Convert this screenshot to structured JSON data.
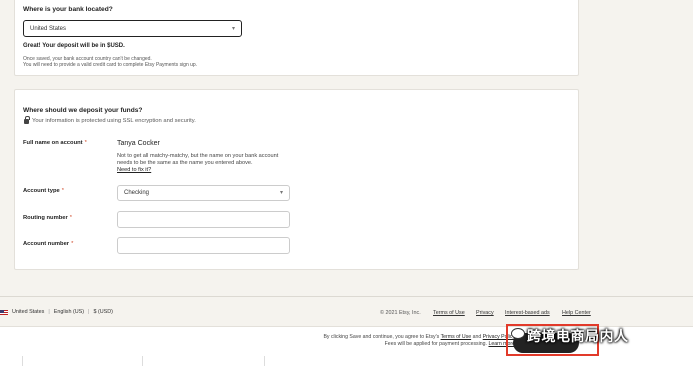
{
  "bank_location": {
    "question": "Where is your bank located?",
    "selected_country": "United States",
    "deposit_message": "Great! Your deposit will be in $USD.",
    "note_line1": "Once saved, your bank account country can't be changed.",
    "note_line2": "You will need to provide a valid credit card to complete Etsy Payments sign up."
  },
  "deposit": {
    "question": "Where should we deposit your funds?",
    "security_note": "Your information is protected using SSL encryption and security.",
    "full_name_label": "Full name on account",
    "full_name_value": "Tanya Cocker",
    "name_warning": "Not to get all matchy-matchy, but the name on your bank account needs to be the same as the name you entered above.",
    "fix_link": "Need to fix it?",
    "account_type_label": "Account type",
    "account_type_value": "Checking",
    "routing_label": "Routing number",
    "account_number_label": "Account number",
    "required_marker": "*"
  },
  "footer": {
    "region": "United States",
    "language": "English (US)",
    "currency": "$ (USD)",
    "separator": "|",
    "copyright": "© 2021 Etsy, Inc.",
    "links": [
      "Terms of Use",
      "Privacy",
      "Interest-based ads",
      "Help Center"
    ]
  },
  "agreement": {
    "line1_pre": "By clicking Save and continue, you agree to Etsy's",
    "terms_link": "Terms of Use",
    "and": "and",
    "privacy_link": "Privacy Policy",
    "line2_pre": "Fees will be applied for payment processing.",
    "learn_more": "Learn more"
  },
  "watermark": {
    "text": "跨境电商局内人"
  },
  "colors": {
    "background": "#f5f3ee",
    "required": "#d14a2a",
    "highlight_box": "#e23a2a",
    "button": "#222222"
  }
}
